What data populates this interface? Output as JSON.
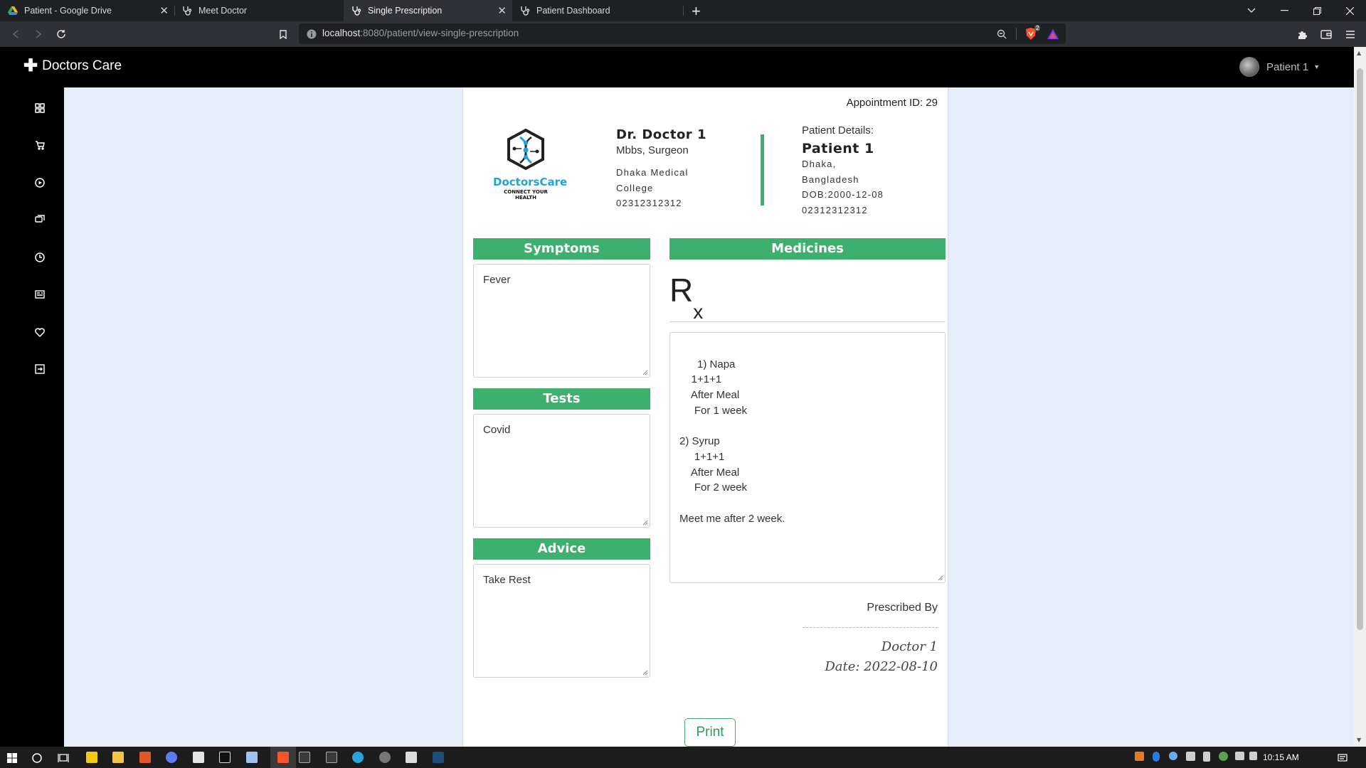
{
  "browser": {
    "tabs": [
      {
        "title": "Patient - Google Drive",
        "icon": "google-drive-icon"
      },
      {
        "title": "Meet Doctor",
        "icon": "stethoscope-icon"
      },
      {
        "title": "Single Prescription",
        "icon": "stethoscope-icon",
        "active": true
      },
      {
        "title": "Patient Dashboard",
        "icon": "stethoscope-icon"
      }
    ],
    "url_host": "localhost",
    "url_path": ":8080/patient/view-single-prescription",
    "shield_badge": "2"
  },
  "app": {
    "brand": "Doctors Care",
    "user": "Patient 1"
  },
  "sidebar": {
    "icons": [
      "dashboard-icon",
      "cart-icon",
      "play-icon",
      "chat-icon",
      "history-icon",
      "news-icon",
      "heart-icon",
      "logout-icon"
    ]
  },
  "prescription": {
    "appointment_label": "Appointment ID: 29",
    "logo": {
      "name": "DoctorsCare",
      "tagline": "CONNECT YOUR HEALTH"
    },
    "doctor": {
      "name": "Dr. Doctor 1",
      "degree": "Mbbs, Surgeon",
      "college_line1": "Dhaka Medical",
      "college_line2": "College",
      "phone": "02312312312"
    },
    "patient": {
      "label": "Patient Details:",
      "name": "Patient 1",
      "address_line1": "Dhaka,",
      "address_line2": "Bangladesh",
      "dob": "DOB:2000-12-08",
      "phone": "02312312312"
    },
    "symptoms": {
      "heading": "Symptoms",
      "value": "Fever"
    },
    "tests": {
      "heading": "Tests",
      "value": "Covid"
    },
    "advice": {
      "heading": "Advice",
      "value": "Take Rest"
    },
    "medicines": {
      "heading": "Medicines",
      "rx": "R",
      "rx_sub": "x",
      "value": "1) Napa\n    1+1+1\n    After Meal\n     For 1 week\n\n2) Syrup\n     1+1+1\n    After Meal\n     For 2 week\n\nMeet me after 2 week."
    },
    "prescribed_by_label": "Prescribed By",
    "signature_name": "Doctor 1",
    "signature_date": "Date: 2022-08-10",
    "print_label": "Print"
  },
  "taskbar": {
    "time": "10:15 AM"
  }
}
